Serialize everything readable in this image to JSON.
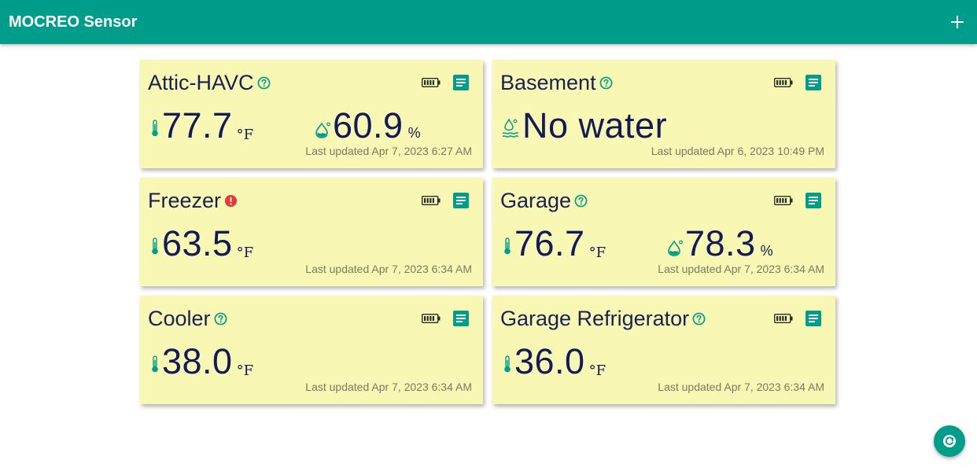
{
  "app": {
    "title": "MOCREO Sensor"
  },
  "colors": {
    "brand": "#009e8a",
    "card_bg": "#f8f8b4",
    "value_text": "#141a58",
    "alert": "#e53935"
  },
  "icons": {
    "add": "plus-icon",
    "help": "help-circle-icon",
    "alert": "alert-circle-icon",
    "battery": "battery-full-icon",
    "log": "log-document-icon",
    "temperature": "thermometer-icon",
    "humidity": "water-drop-icon",
    "leak": "water-leak-icon",
    "refresh": "refresh-icon"
  },
  "sensors": [
    {
      "name": "Attic-HAVC",
      "status": "help",
      "temperature": "77.7",
      "temp_unit": "°F",
      "humidity": "60.9",
      "humidity_unit": "%",
      "updated": "Last updated Apr 7, 2023 6:27 AM"
    },
    {
      "name": "Basement",
      "status": "help",
      "leak_status": "No water",
      "updated": "Last updated Apr 6, 2023 10:49 PM"
    },
    {
      "name": "Freezer",
      "status": "alert",
      "temperature": "63.5",
      "temp_unit": "°F",
      "updated": "Last updated Apr 7, 2023 6:34 AM"
    },
    {
      "name": "Garage",
      "status": "help",
      "temperature": "76.7",
      "temp_unit": "°F",
      "humidity": "78.3",
      "humidity_unit": "%",
      "updated": "Last updated Apr 7, 2023 6:34 AM"
    },
    {
      "name": "Cooler",
      "status": "help",
      "temperature": "38.0",
      "temp_unit": "°F",
      "updated": "Last updated Apr 7, 2023 6:34 AM"
    },
    {
      "name": "Garage Refrigerator",
      "status": "help",
      "temperature": "36.0",
      "temp_unit": "°F",
      "updated": "Last updated Apr 7, 2023 6:34 AM"
    }
  ]
}
